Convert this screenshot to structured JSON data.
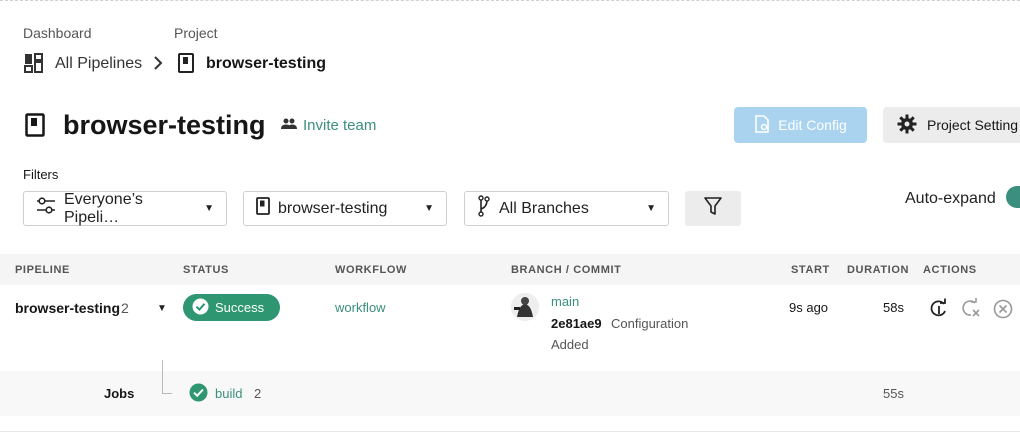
{
  "breadcrumb": {
    "dashboard_label": "Dashboard",
    "project_label": "Project",
    "all_pipelines": "All Pipelines",
    "project_name": "browser-testing"
  },
  "header": {
    "title": "browser-testing",
    "invite_team": "Invite team",
    "edit_config": "Edit Config",
    "project_settings": "Project Setting"
  },
  "filters": {
    "label": "Filters",
    "pipelines": "Everyone’s Pipeli…",
    "project": "browser-testing",
    "branches": "All Branches",
    "auto_expand": "Auto-expand"
  },
  "table": {
    "headers": [
      "PIPELINE",
      "STATUS",
      "WORKFLOW",
      "BRANCH / COMMIT",
      "START",
      "DURATION",
      "ACTIONS"
    ],
    "row": {
      "pipeline": "browser-testing",
      "pipeline_number": "2",
      "status": "Success",
      "workflow": "workflow",
      "branch": "main",
      "commit_hash": "2e81ae9",
      "commit_msg_1": "Configuration",
      "commit_msg_2": "Added",
      "start": "9s ago",
      "duration": "58s"
    },
    "jobs": {
      "label": "Jobs",
      "job_name": "build",
      "job_number": "2",
      "duration": "55s"
    }
  },
  "colors": {
    "accent_green": "#3b8f7e",
    "success_badge": "#2e9670",
    "edit_config_bg": "#a9d3ee"
  }
}
